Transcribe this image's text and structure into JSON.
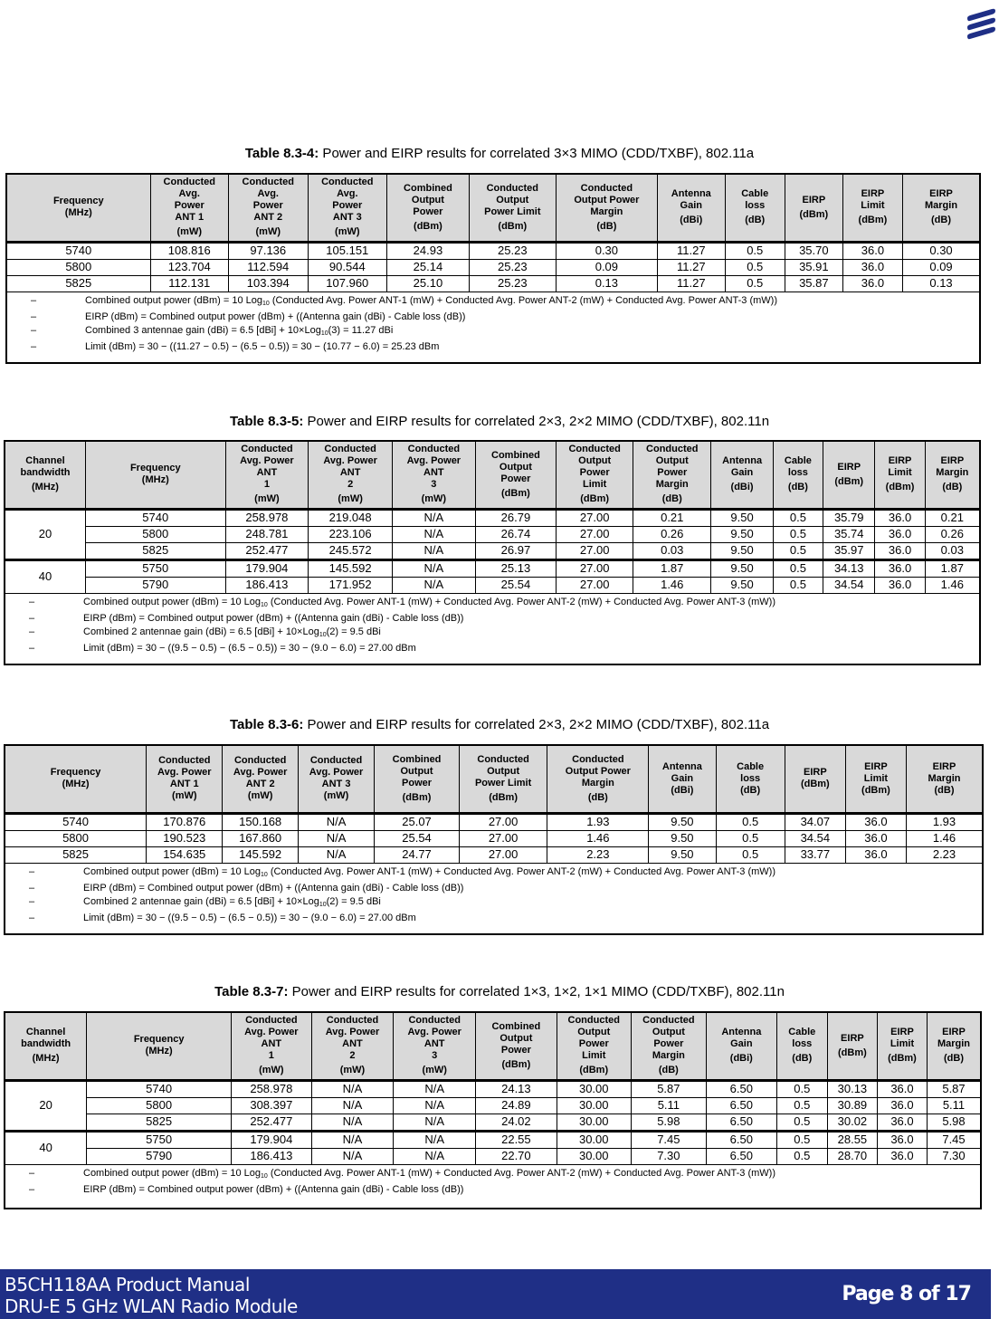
{
  "header": {
    "logo": "ericsson-logo"
  },
  "tables": [
    {
      "id": "t4",
      "caption_bold": "Table 8.3-4:",
      "caption_text": " Power and EIRP results for correlated 3×3 MIMO (CDD/TXBF), 802.11a",
      "headers": [
        {
          "label": "Frequency\n(MHz)",
          "unit": ""
        },
        {
          "label": "Conducted\nAvg.\nPower\nANT 1",
          "unit": "(mW)"
        },
        {
          "label": "Conducted\nAvg.\nPower\nANT 2",
          "unit": "(mW)"
        },
        {
          "label": "Conducted\nAvg.\nPower\nANT 3",
          "unit": "(mW)"
        },
        {
          "label": "Combined\nOutput\nPower",
          "unit": "(dBm)"
        },
        {
          "label": "Conducted\nOutput\nPower Limit",
          "unit": "(dBm)"
        },
        {
          "label": "Conducted\nOutput Power\nMargin",
          "unit": "(dB)"
        },
        {
          "label": "Antenna\nGain",
          "unit": "(dBi)"
        },
        {
          "label": "Cable\nloss",
          "unit": "(dB)"
        },
        {
          "label": "EIRP",
          "unit": "(dBm)"
        },
        {
          "label": "EIRP\nLimit",
          "unit": "(dBm)"
        },
        {
          "label": "EIRP\nMargin",
          "unit": "(dB)"
        }
      ],
      "rows": [
        [
          "5740",
          "108.816",
          "97.136",
          "105.151",
          "24.93",
          "25.23",
          "0.30",
          "11.27",
          "0.5",
          "35.70",
          "36.0",
          "0.30"
        ],
        [
          "5800",
          "123.704",
          "112.594",
          "90.544",
          "25.14",
          "25.23",
          "0.09",
          "11.27",
          "0.5",
          "35.91",
          "36.0",
          "0.09"
        ],
        [
          "5825",
          "112.131",
          "103.394",
          "107.960",
          "25.10",
          "25.23",
          "0.13",
          "11.27",
          "0.5",
          "35.87",
          "36.0",
          "0.13"
        ]
      ],
      "notes": [
        {
          "dash": "–",
          "text": "Combined output power (dBm) = 10 Log",
          "sub": "10",
          "rest": " (Conducted Avg. Power ANT-1 (mW) + Conducted Avg. Power ANT-2 (mW) + Conducted Avg. Power ANT-3 (mW))"
        },
        {
          "dash": "–",
          "text": "EIRP (dBm) = Combined output power (dBm) + ((Antenna gain (dBi) - Cable loss (dB))",
          "sub": "",
          "rest": ""
        },
        {
          "dash": "–",
          "text": "Combined 3 antennae gain (dBi) = 6.5 [dBi] + 10×Log",
          "sub": "10",
          "rest": "(3) = 11.27 dBi"
        },
        {
          "dash": "–",
          "text": "Limit (dBm) = 30 − ((11.27 − 0.5) − (6.5 − 0.5)) = 30 − (10.77 − 6.0) = 25.23 dBm",
          "sub": "",
          "rest": ""
        }
      ]
    },
    {
      "id": "t5",
      "caption_bold": "Table 8.3-5:",
      "caption_text": " Power and EIRP results for correlated 2×3, 2×2 MIMO (CDD/TXBF), 802.11n",
      "headers": [
        {
          "label": "Channel\nbandwidth",
          "unit": "(MHz)"
        },
        {
          "label": "Frequency\n(MHz)",
          "unit": ""
        },
        {
          "label": "Conducted\nAvg. Power\nANT\n1",
          "unit": "(mW)"
        },
        {
          "label": "Conducted\nAvg. Power\nANT\n2",
          "unit": "(mW)"
        },
        {
          "label": "Conducted\nAvg. Power\nANT\n3",
          "unit": "(mW)"
        },
        {
          "label": "Combined\nOutput\nPower",
          "unit": "(dBm)"
        },
        {
          "label": "Conducted\nOutput\nPower\nLimit",
          "unit": "(dBm)"
        },
        {
          "label": "Conducted\nOutput\nPower\nMargin",
          "unit": "(dB)"
        },
        {
          "label": "Antenna\nGain",
          "unit": "(dBi)"
        },
        {
          "label": "Cable\nloss",
          "unit": "(dB)"
        },
        {
          "label": "EIRP",
          "unit": "(dBm)"
        },
        {
          "label": "EIRP\nLimit",
          "unit": "(dBm)"
        },
        {
          "label": "EIRP\nMargin",
          "unit": "(dB)"
        }
      ],
      "groups": [
        {
          "bw": "20",
          "rows": [
            [
              "5740",
              "258.978",
              "219.048",
              "N/A",
              "26.79",
              "27.00",
              "0.21",
              "9.50",
              "0.5",
              "35.79",
              "36.0",
              "0.21"
            ],
            [
              "5800",
              "248.781",
              "223.106",
              "N/A",
              "26.74",
              "27.00",
              "0.26",
              "9.50",
              "0.5",
              "35.74",
              "36.0",
              "0.26"
            ],
            [
              "5825",
              "252.477",
              "245.572",
              "N/A",
              "26.97",
              "27.00",
              "0.03",
              "9.50",
              "0.5",
              "35.97",
              "36.0",
              "0.03"
            ]
          ]
        },
        {
          "bw": "40",
          "rows": [
            [
              "5750",
              "179.904",
              "145.592",
              "N/A",
              "25.13",
              "27.00",
              "1.87",
              "9.50",
              "0.5",
              "34.13",
              "36.0",
              "1.87"
            ],
            [
              "5790",
              "186.413",
              "171.952",
              "N/A",
              "25.54",
              "27.00",
              "1.46",
              "9.50",
              "0.5",
              "34.54",
              "36.0",
              "1.46"
            ]
          ]
        }
      ],
      "notes": [
        {
          "dash": "–",
          "text": "Combined output power (dBm) = 10 Log",
          "sub": "10",
          "rest": " (Conducted Avg. Power ANT-1 (mW) + Conducted Avg. Power ANT-2 (mW) + Conducted Avg. Power ANT-3 (mW))"
        },
        {
          "dash": "–",
          "text": "EIRP (dBm) = Combined output power (dBm) + ((Antenna gain (dBi) - Cable loss (dB))",
          "sub": "",
          "rest": ""
        },
        {
          "dash": "–",
          "text": "Combined 2 antennae gain (dBi) = 6.5 [dBi] + 10×Log",
          "sub": "10",
          "rest": "(2) = 9.5 dBi"
        },
        {
          "dash": "–",
          "text": "Limit (dBm) = 30 − ((9.5 − 0.5) − (6.5 − 0.5)) = 30 − (9.0 − 6.0) = 27.00 dBm",
          "sub": "",
          "rest": ""
        }
      ]
    },
    {
      "id": "t6",
      "caption_bold": "Table 8.3-6:",
      "caption_text": " Power and EIRP results for correlated 2×3, 2×2 MIMO (CDD/TXBF), 802.11a",
      "headers": [
        {
          "label": "Frequency\n(MHz)",
          "unit": ""
        },
        {
          "label": "Conducted\nAvg. Power\nANT 1\n(mW)",
          "unit": ""
        },
        {
          "label": "Conducted\nAvg. Power\nANT 2\n(mW)",
          "unit": ""
        },
        {
          "label": "Conducted\nAvg. Power\nANT 3\n(mW)",
          "unit": ""
        },
        {
          "label": "Combined\nOutput\nPower",
          "unit": "(dBm)"
        },
        {
          "label": "Conducted\nOutput\nPower Limit",
          "unit": "(dBm)"
        },
        {
          "label": "Conducted\nOutput Power\nMargin",
          "unit": "(dB)"
        },
        {
          "label": "Antenna\nGain\n(dBi)",
          "unit": ""
        },
        {
          "label": "Cable\nloss\n(dB)",
          "unit": ""
        },
        {
          "label": "EIRP\n(dBm)",
          "unit": ""
        },
        {
          "label": "EIRP\nLimit\n(dBm)",
          "unit": ""
        },
        {
          "label": "EIRP\nMargin\n(dB)",
          "unit": ""
        }
      ],
      "rows": [
        [
          "5740",
          "170.876",
          "150.168",
          "N/A",
          "25.07",
          "27.00",
          "1.93",
          "9.50",
          "0.5",
          "34.07",
          "36.0",
          "1.93"
        ],
        [
          "5800",
          "190.523",
          "167.860",
          "N/A",
          "25.54",
          "27.00",
          "1.46",
          "9.50",
          "0.5",
          "34.54",
          "36.0",
          "1.46"
        ],
        [
          "5825",
          "154.635",
          "145.592",
          "N/A",
          "24.77",
          "27.00",
          "2.23",
          "9.50",
          "0.5",
          "33.77",
          "36.0",
          "2.23"
        ]
      ],
      "notes": [
        {
          "dash": "–",
          "text": "Combined output power (dBm) = 10 Log",
          "sub": "10",
          "rest": " (Conducted Avg. Power ANT-1 (mW) + Conducted Avg. Power ANT-2 (mW) + Conducted Avg. Power ANT-3 (mW))"
        },
        {
          "dash": "–",
          "text": "EIRP (dBm) = Combined output power (dBm) + ((Antenna gain (dBi) - Cable loss (dB))",
          "sub": "",
          "rest": ""
        },
        {
          "dash": "–",
          "text": "Combined 2 antennae gain (dBi) = 6.5 [dBi] + 10×Log",
          "sub": "10",
          "rest": "(2) = 9.5 dBi"
        },
        {
          "dash": "–",
          "text": "Limit (dBm) = 30 − ((9.5 − 0.5) − (6.5 − 0.5)) = 30 − (9.0 − 6.0) = 27.00 dBm",
          "sub": "",
          "rest": ""
        }
      ]
    },
    {
      "id": "t7",
      "caption_bold": "Table 8.3-7:",
      "caption_text": " Power and EIRP results for correlated 1×3, 1×2, 1×1 MIMO (CDD/TXBF), 802.11n",
      "headers": [
        {
          "label": "Channel\nbandwidth",
          "unit": "(MHz)"
        },
        {
          "label": "Frequency\n(MHz)",
          "unit": ""
        },
        {
          "label": "Conducted\nAvg. Power\nANT\n1",
          "unit": "(mW)"
        },
        {
          "label": "Conducted\nAvg. Power\nANT\n2",
          "unit": "(mW)"
        },
        {
          "label": "Conducted\nAvg. Power\nANT\n3",
          "unit": "(mW)"
        },
        {
          "label": "Combined\nOutput\nPower",
          "unit": "(dBm)"
        },
        {
          "label": "Conducted\nOutput\nPower\nLimit",
          "unit": "(dBm)"
        },
        {
          "label": "Conducted\nOutput\nPower\nMargin",
          "unit": "(dB)"
        },
        {
          "label": "Antenna\nGain",
          "unit": "(dBi)"
        },
        {
          "label": "Cable\nloss",
          "unit": "(dB)"
        },
        {
          "label": "EIRP",
          "unit": "(dBm)"
        },
        {
          "label": "EIRP\nLimit",
          "unit": "(dBm)"
        },
        {
          "label": "EIRP\nMargin",
          "unit": "(dB)"
        }
      ],
      "groups": [
        {
          "bw": "20",
          "rows": [
            [
              "5740",
              "258.978",
              "N/A",
              "N/A",
              "24.13",
              "30.00",
              "5.87",
              "6.50",
              "0.5",
              "30.13",
              "36.0",
              "5.87"
            ],
            [
              "5800",
              "308.397",
              "N/A",
              "N/A",
              "24.89",
              "30.00",
              "5.11",
              "6.50",
              "0.5",
              "30.89",
              "36.0",
              "5.11"
            ],
            [
              "5825",
              "252.477",
              "N/A",
              "N/A",
              "24.02",
              "30.00",
              "5.98",
              "6.50",
              "0.5",
              "30.02",
              "36.0",
              "5.98"
            ]
          ]
        },
        {
          "bw": "40",
          "rows": [
            [
              "5750",
              "179.904",
              "N/A",
              "N/A",
              "22.55",
              "30.00",
              "7.45",
              "6.50",
              "0.5",
              "28.55",
              "36.0",
              "7.45"
            ],
            [
              "5790",
              "186.413",
              "N/A",
              "N/A",
              "22.70",
              "30.00",
              "7.30",
              "6.50",
              "0.5",
              "28.70",
              "36.0",
              "7.30"
            ]
          ]
        }
      ],
      "notes": [
        {
          "dash": "–",
          "text": "Combined output power (dBm) = 10 Log",
          "sub": "10",
          "rest": " (Conducted Avg. Power ANT-1 (mW) + Conducted Avg. Power ANT-2 (mW) + Conducted Avg. Power ANT-3 (mW))"
        },
        {
          "dash": "–",
          "text": "EIRP (dBm) = Combined output power (dBm) + ((Antenna gain (dBi) - Cable loss (dB))",
          "sub": "",
          "rest": ""
        }
      ]
    }
  ],
  "footer": {
    "line1": "B5CH118AA Product Manual",
    "line2": "DRU-E 5 GHz WLAN Radio Module",
    "page": "Page 8 of 17",
    "bg_color": "#1f2f86"
  }
}
